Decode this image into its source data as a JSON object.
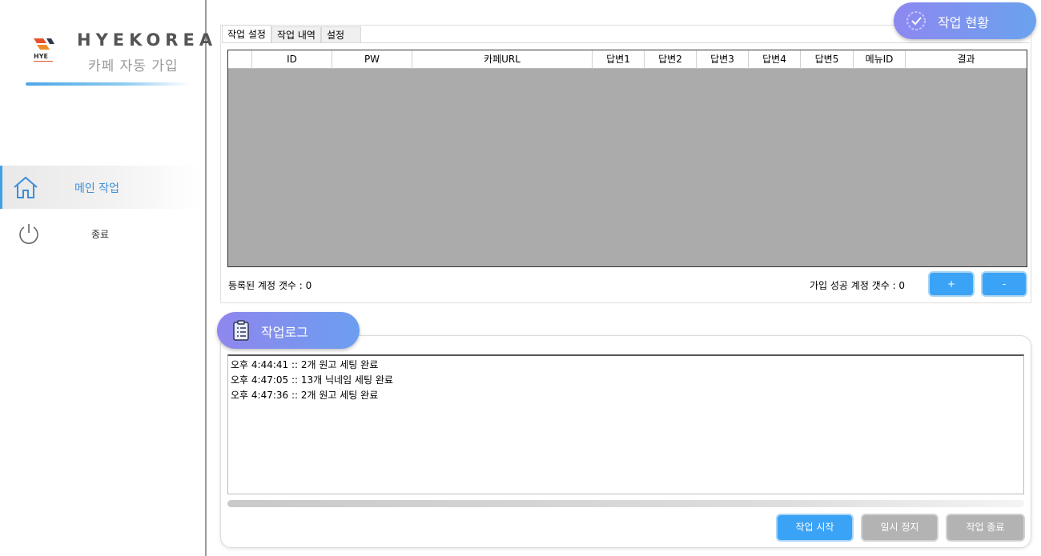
{
  "sidebar": {
    "brand_name": "HYEKOREA",
    "brand_sub": "카페 자동 가입",
    "logo_text": "HYE",
    "nav": [
      {
        "label": "메인 작업",
        "icon": "home-icon",
        "active": true
      },
      {
        "label": "종료",
        "icon": "power-icon",
        "active": false
      }
    ]
  },
  "status_header": {
    "label": "작업 현황",
    "icon": "check-badge-icon"
  },
  "tabs": [
    "작업 설정",
    "작업 내역",
    "설정"
  ],
  "grid": {
    "columns": [
      "",
      "ID",
      "PW",
      "카페URL",
      "답변1",
      "답변2",
      "답변3",
      "답변4",
      "답변5",
      "메뉴ID",
      "결과"
    ],
    "rows": []
  },
  "counts": {
    "registered_label": "등록된 계정 갯수 :  0",
    "success_label": "가입 성공 계정 갯수 :  0"
  },
  "grid_buttons": {
    "add": "+",
    "remove": "-"
  },
  "log_header": {
    "label": "작업로그",
    "icon": "clipboard-icon"
  },
  "log_lines": [
    "오후 4:44:41 ::  2개 원고 세팅 완료",
    "오후 4:47:05 ::  13개 닉네임 세팅 완료",
    "오후 4:47:36 ::  2개 원고 세팅 완료"
  ],
  "actions": {
    "start": "작업 시작",
    "pause": "일시 정지",
    "stop": "작업 종료"
  },
  "colors": {
    "accent": "#3aa3f5",
    "disabled": "#b3b3b3",
    "pill_start": "#8d88f0",
    "pill_end": "#6aa2ee",
    "nav_text": "#3e8fd8"
  }
}
